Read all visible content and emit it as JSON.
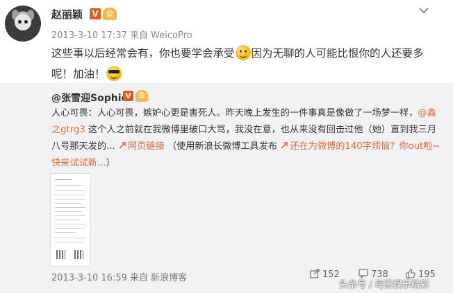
{
  "post": {
    "username": "赵丽颖",
    "verified_badge": "V",
    "vip_badge": "会",
    "timestamp": "2013-3-10 17:37",
    "source_prefix": "来自",
    "source": "WeicoPro",
    "menu_icon": "chevron-down-icon",
    "text_part1": "这些事以后经常会有，你也要学会承受",
    "text_part2": "因为无聊的人可能比恨你的人还要多呢！加油！"
  },
  "repost": {
    "username": "@张雪迎Sophie",
    "verified_badge": "V",
    "vip_badge": "会",
    "text_part1": "人心可畏：人心可畏，嫉妒心更是害死人。昨天晚上发生的一件事真是像做了一场梦一样，",
    "mention": "@鑫之gtrg3",
    "text_part2": " 这个人之前就在我微博里破口大骂，我没在意，也从来没有回击过他（她）直到我三月八号那天发的... ",
    "weblink_icon": "link-icon",
    "weblink": "网页链接",
    "text_part3": "（使用新浪长微博工具发布 ",
    "promo_link": "还在为微博的140字烦恼？你out啦~快来试试新...",
    "text_part4": "）",
    "timestamp": "2013-3-10 16:59",
    "source_prefix": "来自",
    "source": "新浪博客",
    "actions": {
      "repost_count": "152",
      "comment_count": "738",
      "like_count": "195"
    }
  },
  "watermark": "头条号 / 每日娱乐精彩"
}
